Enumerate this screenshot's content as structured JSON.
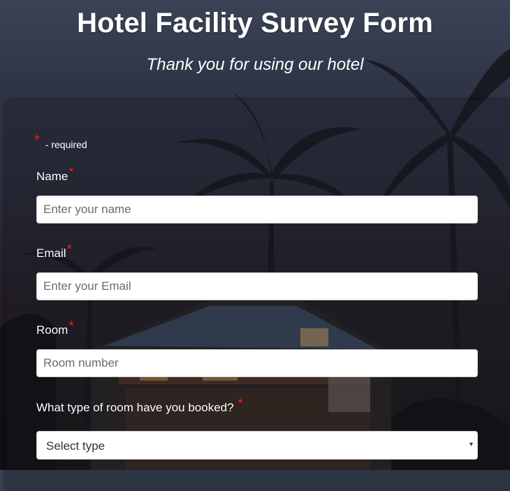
{
  "page": {
    "title": "Hotel Facility Survey Form",
    "subtitle": "Thank you for using our hotel"
  },
  "form": {
    "required_note": {
      "star": "*",
      "text": "- required"
    },
    "fields": [
      {
        "label": "Name",
        "star": "*",
        "placeholder": "Enter your name",
        "value": ""
      },
      {
        "label": "Email",
        "star": "*",
        "placeholder": "Enter your Email",
        "value": ""
      },
      {
        "label": "Room",
        "star": "*",
        "placeholder": "Room number",
        "value": ""
      }
    ],
    "room_type": {
      "label": "What type of room have you booked?",
      "star": "*",
      "selected": "Select type"
    }
  },
  "colors": {
    "required_star": "#ff1a1a",
    "input_background": "#ffffff",
    "text": "#ffffff"
  },
  "icons": {
    "select_caret": "▾"
  }
}
